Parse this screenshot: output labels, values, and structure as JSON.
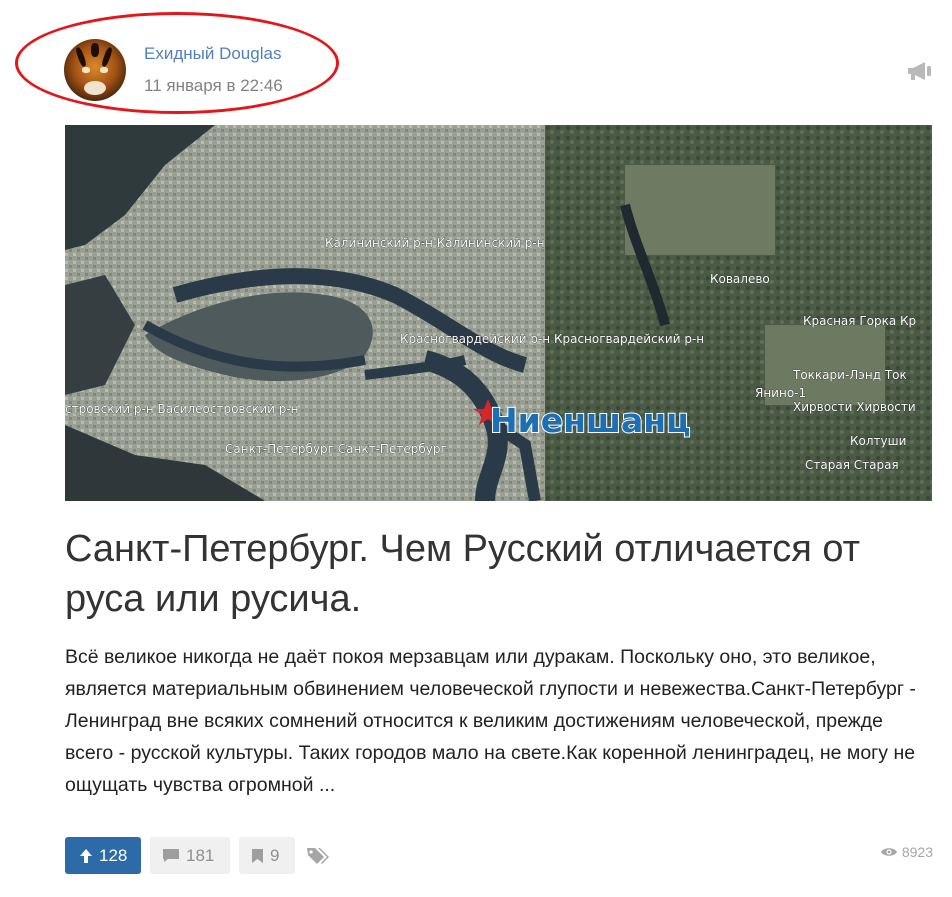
{
  "author": {
    "name": "Ехидный Douglas",
    "date": "11 января в 22:46"
  },
  "icons": {
    "promo": "megaphone-icon",
    "upvote": "arrow-up-icon",
    "comments": "comment-icon",
    "bookmarks": "bookmark-icon",
    "tags": "tags-icon",
    "views": "eye-icon"
  },
  "cover": {
    "labels": [
      "Калининский р-н  Калининский р-н",
      "Ковалево",
      "Красная Горка  Кр",
      "Красногвардейский р-н  Красногвардейский р-н",
      "Токкари-Лэнд  Ток",
      "Янино-1",
      "стровский р-н  Василеостровский р-н",
      "Хирвости  Хирвости",
      "Колтуши",
      "Санкт-Петербург  Санкт-Петербург",
      "Старая  Старая"
    ],
    "title": "Ниеншанц"
  },
  "article": {
    "title": "Санкт-Петербург. Чем Русский отличается от руса или русича.",
    "excerpt": "Всё великое никогда не даёт покоя мерзавцам или дуракам. Поскольку оно, это великое, является материальным обвинением человеческой глупости и невежества.Санкт-Петербург - Ленинград вне всяких сомнений относится к великим достижениям человеческой, прежде всего - русской культуры. Таких городов мало на свете.Как коренной ленинградец, не могу не ощущать чувства огромной ..."
  },
  "actions": {
    "upvotes": "128",
    "comments": "181",
    "bookmarks": "9",
    "views": "8923"
  },
  "colors": {
    "accent": "#2c6aa8",
    "link": "#5181b8",
    "highlight": "#e5161b"
  }
}
